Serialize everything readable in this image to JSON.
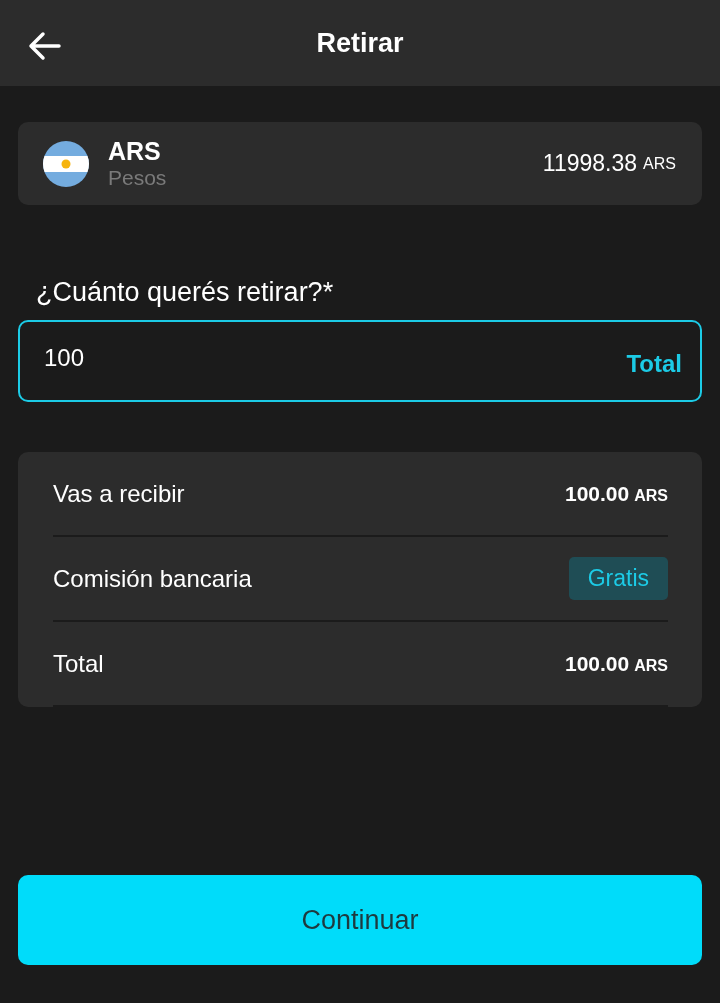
{
  "header": {
    "title": "Retirar"
  },
  "account": {
    "code": "ARS",
    "name": "Pesos",
    "balance": "11998.38",
    "unit": "ARS"
  },
  "amount_field": {
    "label": "¿Cuánto querés retirar?*",
    "value": "100",
    "action": "Total"
  },
  "summary": [
    {
      "kind": "amount",
      "label": "Vas a recibir",
      "value": "100.00",
      "unit": "ARS"
    },
    {
      "kind": "badge",
      "label": "Comisión bancaria",
      "value": "Gratis"
    },
    {
      "kind": "amount",
      "label": "Total",
      "value": "100.00",
      "unit": "ARS"
    }
  ],
  "button": {
    "label": "Continuar"
  }
}
